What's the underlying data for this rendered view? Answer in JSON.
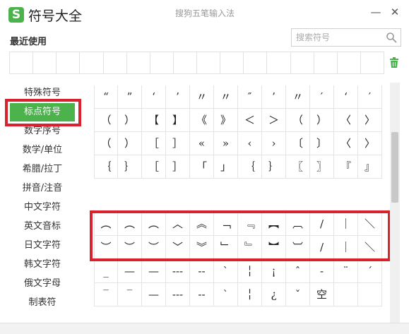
{
  "app": {
    "title": "符号大全",
    "ime_name": "搜狗五笔输入法",
    "minimize": "—",
    "close": "✕",
    "logo": "S"
  },
  "recent": {
    "label": "最近使用",
    "cell_count": 16
  },
  "search": {
    "placeholder": "搜索符号",
    "value": ""
  },
  "sidebar": {
    "items": [
      {
        "label": "特殊符号"
      },
      {
        "label": "标点符号",
        "active": true
      },
      {
        "label": "数字序号"
      },
      {
        "label": "数学/单位"
      },
      {
        "label": "希腊/拉丁"
      },
      {
        "label": "拼音/注音"
      },
      {
        "label": "中文字符"
      },
      {
        "label": "英文音标"
      },
      {
        "label": "日文字符"
      },
      {
        "label": "韩文字符"
      },
      {
        "label": "俄文字母"
      },
      {
        "label": "制表符"
      }
    ]
  },
  "colors": {
    "accent": "#4cb34c",
    "highlight": "#d9232c"
  },
  "symbol_groups": [
    {
      "name": "quotes-brackets",
      "rows": [
        [
          "“",
          "”",
          "‘",
          "’",
          "〃",
          "〃",
          "″",
          "’",
          "〃",
          "′",
          "‘",
          "′"
        ],
        [
          "（",
          "）",
          "【",
          "】",
          "《",
          "》",
          "＜",
          "＞",
          "（",
          "）",
          "〈",
          "〉"
        ],
        [
          "（",
          "）",
          "［",
          "］",
          "«",
          "»",
          "‹",
          "›",
          "〔",
          "〕",
          "〈",
          "〉"
        ],
        [
          "｛",
          "｝",
          "［",
          "］",
          "「",
          "」",
          "｛",
          "｝",
          "〖",
          "〗",
          "『",
          "』"
        ]
      ]
    },
    {
      "name": "vertical-brackets",
      "rows": [
        [
          "︵",
          "︵",
          "︵",
          "︿",
          "︽",
          "﹁",
          "﹃",
          "︻",
          "︹",
          "∕",
          "｜",
          "＼"
        ],
        [
          "︶",
          "︶",
          "︶",
          "﹀",
          "︾",
          "﹂",
          "﹄",
          "︼",
          "︺",
          "∕",
          "｜",
          "＼"
        ]
      ]
    },
    {
      "name": "dashes-misc",
      "rows": [
        [
          "_",
          "—",
          "—",
          "---",
          "--",
          "ˋ",
          "╎",
          "¡",
          "ˆ",
          "-",
          "¨",
          "ˊ"
        ],
        [
          "‾",
          "‾",
          "—",
          "---",
          "--",
          "ˋ",
          "╎",
          "¿",
          "ˇ",
          "空",
          "",
          ""
        ]
      ]
    }
  ]
}
